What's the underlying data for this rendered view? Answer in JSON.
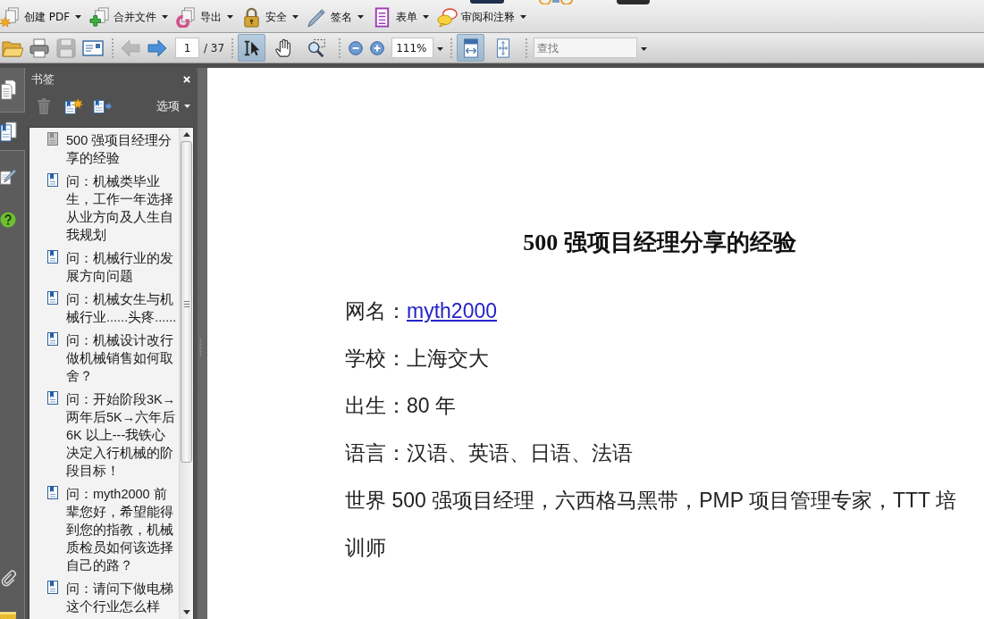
{
  "command_bar": [
    {
      "kind": "create",
      "label": "创建 PDF"
    },
    {
      "kind": "combine",
      "label": "合并文件"
    },
    {
      "kind": "export",
      "label": "导出"
    },
    {
      "kind": "secure",
      "label": "安全"
    },
    {
      "kind": "sign",
      "label": "签名"
    },
    {
      "kind": "forms",
      "label": "表单"
    },
    {
      "kind": "review",
      "label": "审阅和注释"
    }
  ],
  "page_toolbar": {
    "file_buttons": [
      {
        "kind": "open",
        "disabled": false
      },
      {
        "kind": "print",
        "disabled": false
      },
      {
        "kind": "save",
        "disabled": true
      },
      {
        "kind": "email",
        "disabled": false
      }
    ],
    "page_buttons": [
      {
        "kind": "previous",
        "disabled": true
      },
      {
        "kind": "next",
        "disabled": false
      }
    ],
    "page_number": "1",
    "page_count": "/ 37",
    "tools": [
      {
        "kind": "select",
        "selected": true
      },
      {
        "kind": "hand",
        "selected": false
      },
      {
        "kind": "marquee",
        "selected": false
      }
    ],
    "zoom_buttons": [
      {
        "kind": "out"
      },
      {
        "kind": "in"
      }
    ],
    "zoom": "111%",
    "views": [
      {
        "kind": "width",
        "selected": true
      },
      {
        "kind": "page",
        "selected": false
      }
    ],
    "search": {
      "placeholder": "查找"
    }
  },
  "nav_tabs": [
    {
      "kind": "pages",
      "selected": false
    },
    {
      "kind": "bookmarks",
      "selected": true
    },
    {
      "kind": "signatures",
      "selected": false
    }
  ],
  "nav_buttons": [
    {
      "kind": "help"
    },
    {
      "kind": "attachments"
    },
    {
      "kind": "tile"
    }
  ],
  "bookmarks": {
    "title": "书签",
    "options": "选项",
    "buttons": [
      {
        "kind": "delete",
        "disabled": true
      },
      {
        "kind": "new",
        "disabled": false
      },
      {
        "kind": "expand",
        "disabled": false
      }
    ],
    "items": [
      {
        "label": "500 强项目经理分享的经验",
        "current": true
      },
      {
        "label": "问：机械类毕业生，工作一年选择从业方向及人生自我规划",
        "current": false
      },
      {
        "label": "问：机械行业的发展方向问题",
        "current": false
      },
      {
        "label": "问：机械女生与机械行业......头疼......",
        "current": false
      },
      {
        "label": "问：机械设计改行做机械销售如何取舍？",
        "current": false
      },
      {
        "label": "问：开始阶段3K→两年后5K→六年后6K 以上---我铁心决定入行机械的阶段目标！",
        "current": false
      },
      {
        "label": "问：myth2000 前辈您好，希望能得到您的指教，机械质检员如何该选择自己的路？",
        "current": false
      },
      {
        "label": "问：请问下做电梯这个行业怎么样",
        "current": false
      }
    ]
  },
  "document": {
    "title": "500 强项目经理分享的经验",
    "fields": [
      {
        "label": "网名：",
        "value": "myth2000",
        "kind": "link"
      },
      {
        "label": "学校：",
        "value": "上海交大",
        "kind": "text"
      },
      {
        "label": "出生：",
        "value": "80 年",
        "kind": "text"
      },
      {
        "label": "语言：",
        "value": "汉语、英语、日语、法语",
        "kind": "text"
      }
    ],
    "paragraph": "世界 500 强项目经理，六西格马黑带，PMP 项目管理专家，TTT 培训师"
  }
}
